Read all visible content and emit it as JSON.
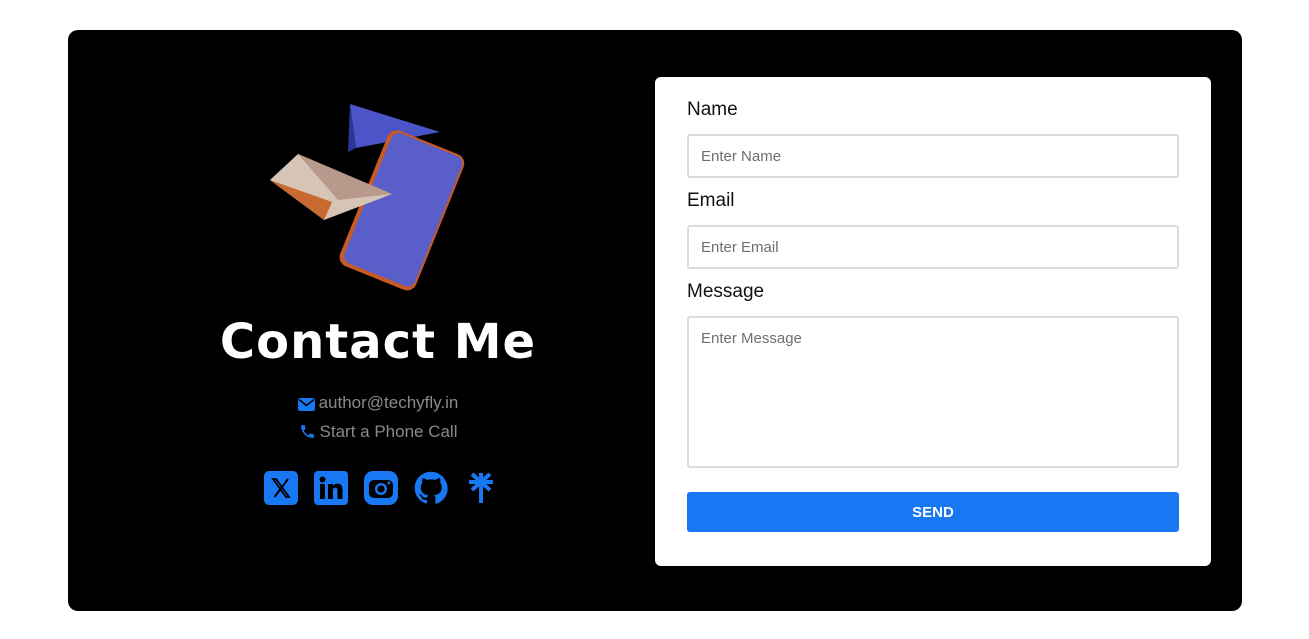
{
  "colors": {
    "accent": "#1877f2",
    "card_bg": "#000000",
    "page_bg": "#ffffff"
  },
  "hero": {
    "title": "Contact Me",
    "email": {
      "icon": "envelope-icon",
      "text": "author@techyfly.in"
    },
    "phone": {
      "icon": "phone-icon",
      "text": "Start a Phone Call"
    }
  },
  "socials": [
    {
      "icon": "x-twitter-icon"
    },
    {
      "icon": "linkedin-icon"
    },
    {
      "icon": "instagram-icon"
    },
    {
      "icon": "github-icon"
    },
    {
      "icon": "linktree-icon"
    }
  ],
  "form": {
    "name_label": "Name",
    "name_placeholder": "Enter Name",
    "email_label": "Email",
    "email_placeholder": "Enter Email",
    "message_label": "Message",
    "message_placeholder": "Enter Message",
    "send_label": "SEND"
  }
}
